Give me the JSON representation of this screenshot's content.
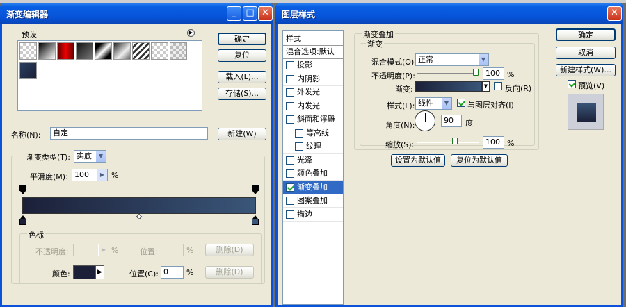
{
  "gradient_editor": {
    "title": "渐变编辑器",
    "presets_label": "预设",
    "buttons": {
      "ok": "确定",
      "reset": "复位",
      "load": "载入(L)...",
      "save": "存储(S)...",
      "new": "新建(W)"
    },
    "name_label": "名称(N):",
    "name_value": "自定",
    "gradient_type_label": "渐变类型(T):",
    "gradient_type_value": "实底",
    "smoothness_label": "平滑度(M):",
    "smoothness_value": "100",
    "percent": "%",
    "stops_group": "色标",
    "opacity_label": "不透明度:",
    "location_label": "位置:",
    "delete_label": "删除(D)",
    "color_label": "颜色:",
    "color_location_label": "位置(C):",
    "color_location_value": "0",
    "gradient_start_color": "#1b2038",
    "gradient_end_color": "#3a5679"
  },
  "layer_style": {
    "title": "图层样式",
    "styles_header": "样式",
    "blend_options": "混合选项:默认",
    "effects": [
      {
        "label": "投影",
        "checked": false,
        "indent": false
      },
      {
        "label": "内阴影",
        "checked": false,
        "indent": false
      },
      {
        "label": "外发光",
        "checked": false,
        "indent": false
      },
      {
        "label": "内发光",
        "checked": false,
        "indent": false
      },
      {
        "label": "斜面和浮雕",
        "checked": false,
        "indent": false
      },
      {
        "label": "等高线",
        "checked": false,
        "indent": true
      },
      {
        "label": "纹理",
        "checked": false,
        "indent": true
      },
      {
        "label": "光泽",
        "checked": false,
        "indent": false
      },
      {
        "label": "颜色叠加",
        "checked": false,
        "indent": false
      },
      {
        "label": "渐变叠加",
        "checked": true,
        "indent": false,
        "selected": true
      },
      {
        "label": "图案叠加",
        "checked": false,
        "indent": false
      },
      {
        "label": "描边",
        "checked": false,
        "indent": false
      }
    ],
    "section_title": "渐变叠加",
    "sub_title": "渐变",
    "blend_mode_label": "混合模式(O):",
    "blend_mode_value": "正常",
    "opacity_label": "不透明度(P):",
    "opacity_value": "100",
    "gradient_label": "渐变:",
    "reverse_label": "反向(R)",
    "style_label": "样式(L):",
    "style_value": "线性",
    "align_label": "与图层对齐(I)",
    "angle_label": "角度(N):",
    "angle_value": "90",
    "degree": "度",
    "scale_label": "缩放(S):",
    "scale_value": "100",
    "percent": "%",
    "set_default": "设置为默认值",
    "reset_default": "复位为默认值",
    "buttons": {
      "ok": "确定",
      "cancel": "取消",
      "new_style": "新建样式(W)...",
      "preview": "预览(V)"
    },
    "opacity_level": 1.0,
    "scale_level": 1.0
  }
}
